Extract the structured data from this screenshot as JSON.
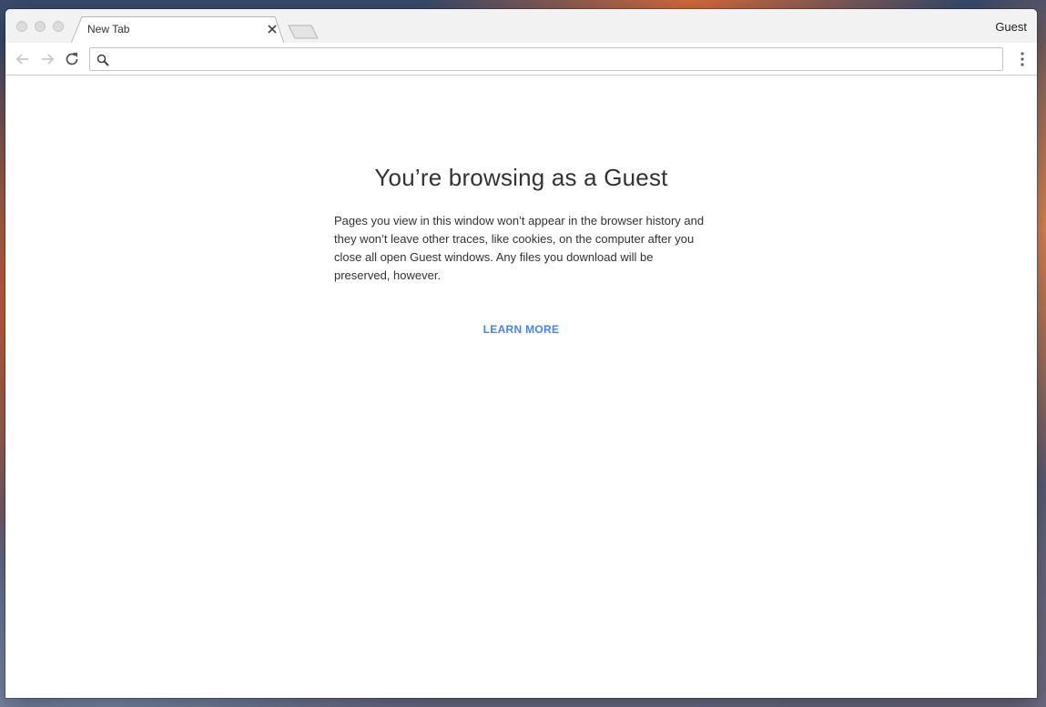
{
  "browser": {
    "tab_title": "New Tab",
    "profile_label": "Guest"
  },
  "toolbar": {
    "omnibox_value": ""
  },
  "page": {
    "headline": "You’re browsing as a Guest",
    "message": "Pages you view in this window won’t appear in the browser history and they won’t leave other traces, like cookies, on the computer after you close all open Guest windows. Any files you download will be preserved, however.",
    "learn_more": "LEARN MORE"
  },
  "colors": {
    "link": "#4285f4",
    "chrome": "#f2f2f2"
  },
  "icons": [
    "back-arrow-icon",
    "forward-arrow-icon",
    "reload-icon",
    "search-icon",
    "menu-dots-icon",
    "close-icon"
  ]
}
